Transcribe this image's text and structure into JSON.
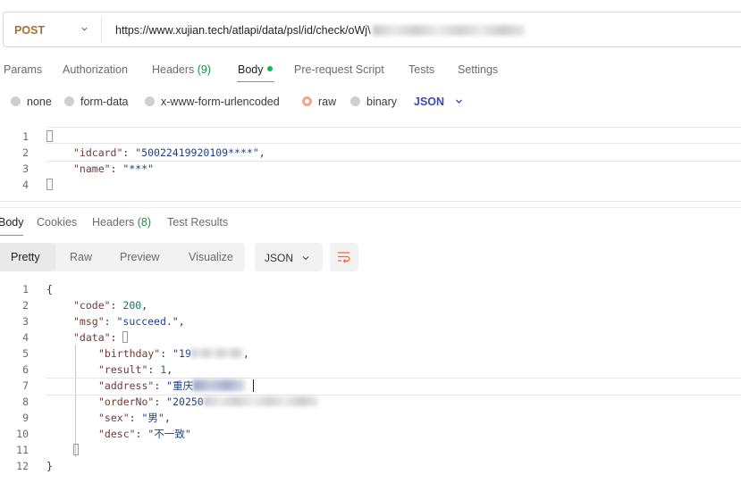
{
  "request": {
    "method": "POST",
    "url_visible": "https://www.xujian.tech/atlapi/data/psl/id/check/oWj\\"
  },
  "request_tabs": [
    {
      "label": "Params"
    },
    {
      "label": "Authorization"
    },
    {
      "label": "Headers",
      "count": "(9)"
    },
    {
      "label": "Body"
    },
    {
      "label": "Pre-request Script"
    },
    {
      "label": "Tests"
    },
    {
      "label": "Settings"
    }
  ],
  "body_types": [
    {
      "label": "none"
    },
    {
      "label": "form-data"
    },
    {
      "label": "x-www-form-urlencoded"
    },
    {
      "label": "raw",
      "selected": true
    },
    {
      "label": "binary"
    }
  ],
  "raw_format": "JSON",
  "request_body": {
    "line_numbers": [
      "1",
      "2",
      "3",
      "4"
    ],
    "open_brace": "{",
    "idcard_key": "\"idcard\"",
    "idcard_value": "\"50022419920109****\"",
    "name_key": "\"name\"",
    "name_value": "\"***\"",
    "close_brace": "}"
  },
  "response_tabs": [
    {
      "label": "Body"
    },
    {
      "label": "Cookies"
    },
    {
      "label": "Headers",
      "count": "(8)"
    },
    {
      "label": "Test Results"
    }
  ],
  "view_modes": [
    "Pretty",
    "Raw",
    "Preview",
    "Visualize"
  ],
  "response_format": "JSON",
  "response_body": {
    "line_numbers": [
      "1",
      "2",
      "3",
      "4",
      "5",
      "6",
      "7",
      "8",
      "9",
      "10",
      "11",
      "12"
    ],
    "code_key": "\"code\"",
    "code_value": "200",
    "msg_key": "\"msg\"",
    "msg_value": "\"succeed.\"",
    "data_key": "\"data\"",
    "birthday_key": "\"birthday\"",
    "birthday_value_visible": "\"19",
    "result_key": "\"result\"",
    "result_value": "1",
    "address_key": "\"address\"",
    "address_value_visible": "\"重庆",
    "orderNo_key": "\"orderNo\"",
    "orderNo_value_visible": "\"20250",
    "sex_key": "\"sex\"",
    "sex_value": "\"男\"",
    "desc_key": "\"desc\"",
    "desc_value": "\"不一致\""
  },
  "colors": {
    "accent": "#f26b3a",
    "method": "#a6702d",
    "count_green": "#1f8a45",
    "json_blue": "#3a4ab2"
  }
}
